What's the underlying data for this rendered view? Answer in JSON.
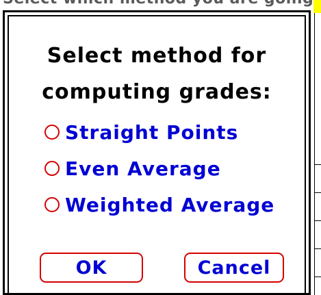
{
  "background": {
    "partial_text": "Select which method you are going to be applying"
  },
  "dialog": {
    "prompt_line1": "Select method for",
    "prompt_line2": "computing grades:",
    "options": [
      {
        "label": "Straight Points",
        "selected": false
      },
      {
        "label": "Even Average",
        "selected": false
      },
      {
        "label": "Weighted Average",
        "selected": false
      }
    ],
    "ok_label": "OK",
    "cancel_label": "Cancel"
  },
  "colors": {
    "label_text": "#0000d4",
    "control_outline": "#d40000",
    "highlight": "#ffff00"
  }
}
